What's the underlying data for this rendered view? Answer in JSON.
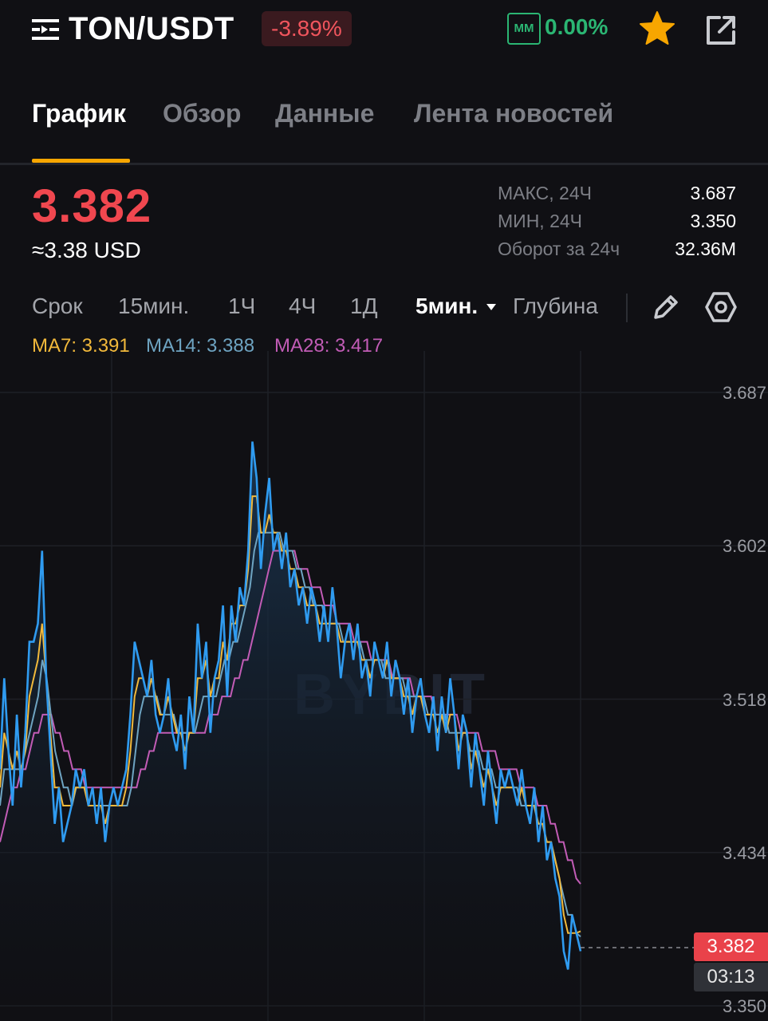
{
  "header": {
    "pair": "TON/USDT",
    "change_pct": "-3.89%",
    "mm_label": "MM",
    "mm_value": "0.00%",
    "icons": [
      "menu-icon",
      "star-icon",
      "share-icon"
    ]
  },
  "tabs": [
    {
      "label": "График",
      "active": true
    },
    {
      "label": "Обзор",
      "active": false
    },
    {
      "label": "Данные",
      "active": false
    },
    {
      "label": "Лента новостей",
      "active": false
    }
  ],
  "price": {
    "last": "3.382",
    "usd": "≈3.38 USD",
    "stats": [
      {
        "label": "МАКС, 24Ч",
        "value": "3.687"
      },
      {
        "label": "МИН, 24Ч",
        "value": "3.350"
      },
      {
        "label": "Оборот за 24ч",
        "value": "32.36M"
      }
    ]
  },
  "timeframes": {
    "items": [
      "Срок",
      "15мин.",
      "1Ч",
      "4Ч",
      "1Д",
      "5мин.",
      "Глубина"
    ],
    "active": "5мин.",
    "tools": [
      "pencil-icon",
      "settings-icon"
    ]
  },
  "ma_legend": {
    "ma7": "MA7: 3.391",
    "ma14": "MA14: 3.388",
    "ma28": "MA28: 3.417"
  },
  "colors": {
    "accent": "#f7a600",
    "down": "#f0474f",
    "up": "#2bb673",
    "price_line": "#2f9bf0",
    "ma7": "#f2b93b",
    "ma14": "#6ea4c2",
    "ma28": "#c25cb6"
  },
  "chart_data": {
    "type": "line",
    "y_ticks": [
      "3.687",
      "3.602",
      "3.518",
      "3.434",
      "3.350"
    ],
    "ylim": [
      3.35,
      3.687
    ],
    "last_price_tag": "3.382",
    "countdown_tag": "03:13",
    "watermark": "BYBIT",
    "series": [
      {
        "name": "price",
        "values": [
          3.48,
          3.53,
          3.49,
          3.46,
          3.51,
          3.47,
          3.5,
          3.55,
          3.55,
          3.56,
          3.6,
          3.53,
          3.49,
          3.45,
          3.47,
          3.44,
          3.45,
          3.46,
          3.48,
          3.47,
          3.48,
          3.46,
          3.47,
          3.45,
          3.47,
          3.44,
          3.46,
          3.47,
          3.46,
          3.47,
          3.48,
          3.51,
          3.55,
          3.54,
          3.53,
          3.52,
          3.54,
          3.51,
          3.5,
          3.51,
          3.53,
          3.5,
          3.49,
          3.51,
          3.48,
          3.52,
          3.5,
          3.56,
          3.53,
          3.55,
          3.5,
          3.53,
          3.54,
          3.57,
          3.52,
          3.57,
          3.55,
          3.58,
          3.57,
          3.6,
          3.66,
          3.64,
          3.59,
          3.62,
          3.64,
          3.6,
          3.61,
          3.59,
          3.61,
          3.58,
          3.59,
          3.57,
          3.58,
          3.56,
          3.58,
          3.57,
          3.55,
          3.57,
          3.55,
          3.58,
          3.56,
          3.53,
          3.55,
          3.56,
          3.54,
          3.56,
          3.53,
          3.54,
          3.52,
          3.55,
          3.54,
          3.53,
          3.55,
          3.52,
          3.54,
          3.53,
          3.51,
          3.53,
          3.5,
          3.52,
          3.53,
          3.51,
          3.5,
          3.52,
          3.49,
          3.52,
          3.5,
          3.53,
          3.51,
          3.48,
          3.51,
          3.5,
          3.47,
          3.5,
          3.48,
          3.46,
          3.49,
          3.47,
          3.45,
          3.48,
          3.47,
          3.48,
          3.47,
          3.46,
          3.48,
          3.46,
          3.45,
          3.47,
          3.44,
          3.46,
          3.43,
          3.44,
          3.42,
          3.41,
          3.38,
          3.37,
          3.4,
          3.39,
          3.38
        ]
      },
      {
        "name": "MA7",
        "values": [
          3.47,
          3.5,
          3.49,
          3.48,
          3.49,
          3.48,
          3.49,
          3.52,
          3.53,
          3.54,
          3.56,
          3.53,
          3.5,
          3.47,
          3.47,
          3.46,
          3.46,
          3.46,
          3.47,
          3.47,
          3.47,
          3.46,
          3.46,
          3.46,
          3.46,
          3.45,
          3.46,
          3.46,
          3.46,
          3.46,
          3.47,
          3.49,
          3.52,
          3.53,
          3.53,
          3.52,
          3.53,
          3.52,
          3.51,
          3.51,
          3.52,
          3.51,
          3.5,
          3.5,
          3.49,
          3.5,
          3.5,
          3.53,
          3.53,
          3.54,
          3.52,
          3.53,
          3.53,
          3.55,
          3.54,
          3.56,
          3.56,
          3.57,
          3.57,
          3.59,
          3.63,
          3.63,
          3.61,
          3.61,
          3.62,
          3.61,
          3.61,
          3.6,
          3.6,
          3.59,
          3.59,
          3.58,
          3.58,
          3.57,
          3.57,
          3.57,
          3.56,
          3.56,
          3.56,
          3.56,
          3.56,
          3.55,
          3.55,
          3.55,
          3.55,
          3.55,
          3.54,
          3.54,
          3.53,
          3.54,
          3.54,
          3.53,
          3.54,
          3.53,
          3.53,
          3.53,
          3.52,
          3.52,
          3.51,
          3.52,
          3.52,
          3.51,
          3.51,
          3.51,
          3.5,
          3.51,
          3.5,
          3.51,
          3.51,
          3.49,
          3.5,
          3.5,
          3.48,
          3.49,
          3.48,
          3.47,
          3.48,
          3.47,
          3.46,
          3.47,
          3.47,
          3.47,
          3.47,
          3.46,
          3.47,
          3.46,
          3.46,
          3.46,
          3.45,
          3.45,
          3.44,
          3.44,
          3.43,
          3.42,
          3.4,
          3.39,
          3.39,
          3.39,
          3.391
        ]
      },
      {
        "name": "MA14",
        "values": [
          3.46,
          3.48,
          3.48,
          3.48,
          3.48,
          3.48,
          3.49,
          3.5,
          3.51,
          3.52,
          3.54,
          3.53,
          3.51,
          3.49,
          3.48,
          3.47,
          3.47,
          3.46,
          3.47,
          3.47,
          3.47,
          3.46,
          3.46,
          3.46,
          3.46,
          3.46,
          3.46,
          3.46,
          3.46,
          3.46,
          3.46,
          3.47,
          3.49,
          3.51,
          3.52,
          3.52,
          3.52,
          3.52,
          3.51,
          3.51,
          3.51,
          3.51,
          3.5,
          3.5,
          3.5,
          3.5,
          3.5,
          3.51,
          3.52,
          3.52,
          3.52,
          3.52,
          3.53,
          3.54,
          3.54,
          3.55,
          3.55,
          3.56,
          3.57,
          3.58,
          3.6,
          3.61,
          3.61,
          3.61,
          3.61,
          3.61,
          3.61,
          3.6,
          3.6,
          3.6,
          3.59,
          3.59,
          3.58,
          3.58,
          3.57,
          3.57,
          3.57,
          3.56,
          3.56,
          3.56,
          3.56,
          3.55,
          3.55,
          3.55,
          3.55,
          3.55,
          3.54,
          3.54,
          3.54,
          3.54,
          3.54,
          3.53,
          3.53,
          3.53,
          3.53,
          3.53,
          3.52,
          3.52,
          3.52,
          3.52,
          3.52,
          3.51,
          3.51,
          3.51,
          3.51,
          3.51,
          3.5,
          3.5,
          3.5,
          3.5,
          3.5,
          3.49,
          3.49,
          3.49,
          3.48,
          3.48,
          3.48,
          3.47,
          3.47,
          3.47,
          3.47,
          3.47,
          3.47,
          3.46,
          3.46,
          3.46,
          3.46,
          3.45,
          3.45,
          3.44,
          3.44,
          3.43,
          3.42,
          3.41,
          3.4,
          3.4,
          3.39,
          3.388
        ]
      },
      {
        "name": "MA28",
        "values": [
          3.44,
          3.45,
          3.46,
          3.47,
          3.47,
          3.48,
          3.48,
          3.49,
          3.5,
          3.5,
          3.51,
          3.51,
          3.51,
          3.5,
          3.5,
          3.49,
          3.49,
          3.48,
          3.48,
          3.48,
          3.47,
          3.47,
          3.47,
          3.47,
          3.47,
          3.47,
          3.47,
          3.47,
          3.47,
          3.47,
          3.47,
          3.47,
          3.47,
          3.48,
          3.48,
          3.49,
          3.49,
          3.5,
          3.5,
          3.5,
          3.5,
          3.5,
          3.5,
          3.5,
          3.5,
          3.5,
          3.5,
          3.5,
          3.5,
          3.51,
          3.51,
          3.51,
          3.52,
          3.52,
          3.52,
          3.53,
          3.53,
          3.54,
          3.54,
          3.55,
          3.56,
          3.57,
          3.58,
          3.59,
          3.6,
          3.6,
          3.6,
          3.6,
          3.6,
          3.6,
          3.59,
          3.59,
          3.59,
          3.58,
          3.58,
          3.58,
          3.57,
          3.57,
          3.57,
          3.56,
          3.56,
          3.56,
          3.56,
          3.55,
          3.55,
          3.55,
          3.55,
          3.54,
          3.54,
          3.54,
          3.54,
          3.54,
          3.53,
          3.53,
          3.53,
          3.53,
          3.53,
          3.52,
          3.52,
          3.52,
          3.52,
          3.52,
          3.51,
          3.51,
          3.51,
          3.51,
          3.51,
          3.51,
          3.5,
          3.5,
          3.5,
          3.5,
          3.5,
          3.49,
          3.49,
          3.49,
          3.49,
          3.48,
          3.48,
          3.48,
          3.48,
          3.48,
          3.47,
          3.47,
          3.47,
          3.47,
          3.46,
          3.46,
          3.46,
          3.45,
          3.45,
          3.44,
          3.44,
          3.43,
          3.43,
          3.42,
          3.417
        ]
      }
    ]
  }
}
